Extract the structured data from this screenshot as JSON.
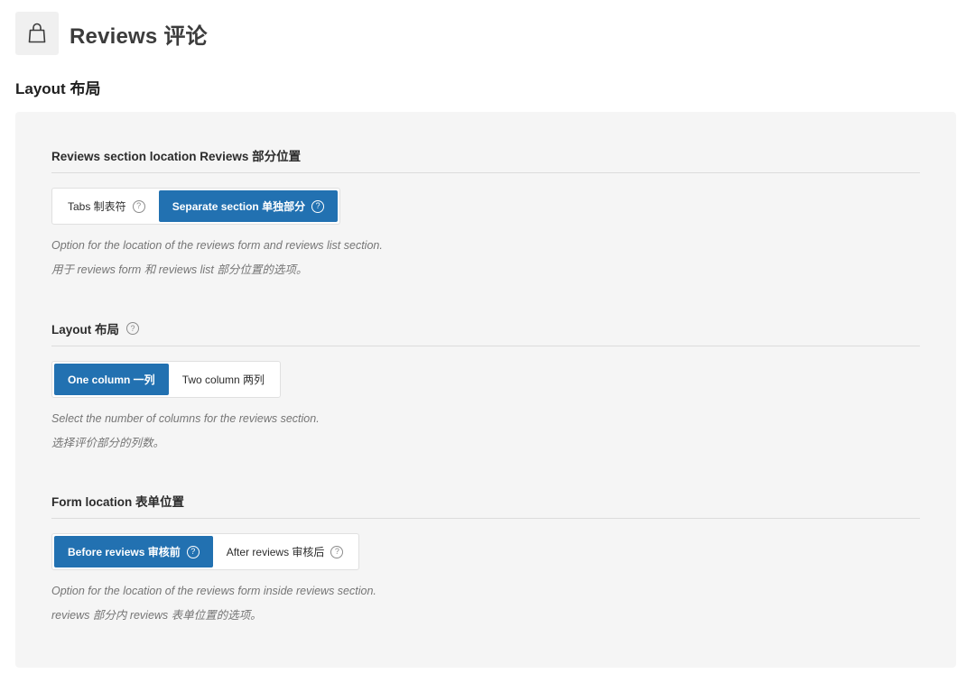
{
  "header": {
    "icon": "shopping-bag-icon",
    "title": "Reviews  评论"
  },
  "section": {
    "title": "Layout  布局"
  },
  "fields": [
    {
      "label": "Reviews section location  Reviews 部分位置",
      "options": [
        {
          "label": "Tabs  制表符",
          "active": false,
          "has_help": true
        },
        {
          "label": "Separate section  单独部分",
          "active": true,
          "has_help": true
        }
      ],
      "description": [
        "Option for the location of the reviews form and reviews list section.",
        "用于 reviews form 和 reviews list 部分位置的选项。"
      ]
    },
    {
      "label": "Layout  布局",
      "label_has_help": true,
      "options": [
        {
          "label": "One column  一列",
          "active": true
        },
        {
          "label": "Two column  两列",
          "active": false
        }
      ],
      "description": [
        "Select the number of columns for the reviews section.",
        "选择评价部分的列数。"
      ]
    },
    {
      "label": "Form location  表单位置",
      "options": [
        {
          "label": "Before reviews  审核前",
          "active": true,
          "has_help": true
        },
        {
          "label": "After reviews  审核后",
          "active": false,
          "has_help": true
        }
      ],
      "description": [
        "Option for the location of the reviews form inside reviews section.",
        "reviews 部分内 reviews 表单位置的选项。"
      ]
    }
  ],
  "help_glyph": "?",
  "colors": {
    "accent": "#2271b1",
    "panel_bg": "#f5f5f5",
    "icon_bg": "#f0f0f0"
  }
}
